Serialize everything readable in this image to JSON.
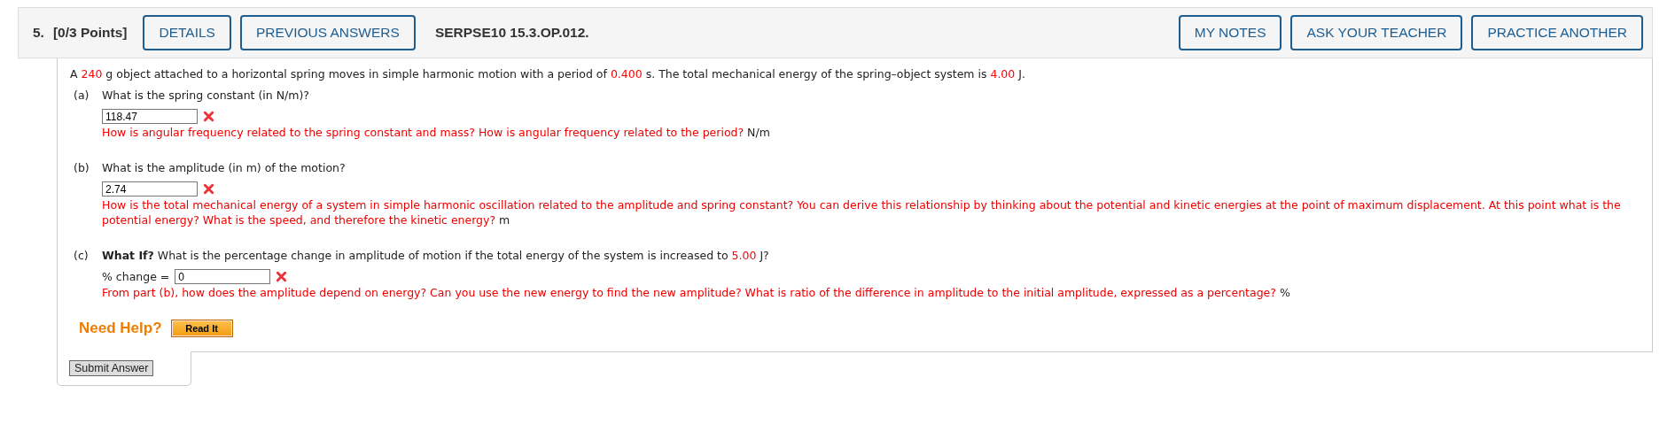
{
  "header": {
    "number": "5.",
    "points": "[0/3 Points]",
    "left_buttons": [
      "DETAILS",
      "PREVIOUS ANSWERS"
    ],
    "code": "SERPSE10 15.3.OP.012.",
    "right_buttons": [
      "MY NOTES",
      "ASK YOUR TEACHER",
      "PRACTICE ANOTHER"
    ]
  },
  "question": [
    {
      "kind": "plain",
      "text": "A "
    },
    {
      "kind": "value",
      "text": "240"
    },
    {
      "kind": "plain",
      "text": " g object attached to a horizontal spring moves in simple harmonic motion with a period of "
    },
    {
      "kind": "value",
      "text": "0.400"
    },
    {
      "kind": "plain",
      "text": " s. The total mechanical energy of the spring–object system is "
    },
    {
      "kind": "value",
      "text": "4.00"
    },
    {
      "kind": "plain",
      "text": " J."
    }
  ],
  "parts": [
    {
      "label": "(a)",
      "prompt": [
        {
          "kind": "plain",
          "text": "What is the spring constant (in N/m)?"
        }
      ],
      "answer": "118.47",
      "correct": false,
      "hint": "How is angular frequency related to the spring constant and mass? How is angular frequency related to the period?",
      "unit": "N/m"
    },
    {
      "label": "(b)",
      "prompt": [
        {
          "kind": "plain",
          "text": "What is the amplitude (in m) of the motion?"
        }
      ],
      "answer": "2.74",
      "correct": false,
      "hint": "How is the total mechanical energy of a system in simple harmonic oscillation related to the amplitude and spring constant? You can derive this relationship by thinking about the potential and kinetic energies at the point of maximum displacement. At this point what is the potential energy? What is the speed, and therefore the kinetic energy?",
      "unit": "m"
    },
    {
      "label": "(c)",
      "prompt": [
        {
          "kind": "bold",
          "text": "What If?"
        },
        {
          "kind": "plain",
          "text": " What is the percentage change in amplitude of motion if the total energy of the system is increased to "
        },
        {
          "kind": "value",
          "text": "5.00"
        },
        {
          "kind": "plain",
          "text": " J?"
        }
      ],
      "field_label": "% change =",
      "answer": "0",
      "correct": false,
      "hint": "From part (b), how does the amplitude depend on energy? Can you use the new energy to find the new amplitude? What is ratio of the difference in amplitude to the initial amplitude, expressed as a percentage?",
      "unit": "%"
    }
  ],
  "help": {
    "label": "Need Help?",
    "button": "Read It"
  },
  "submit": "Submit Answer"
}
